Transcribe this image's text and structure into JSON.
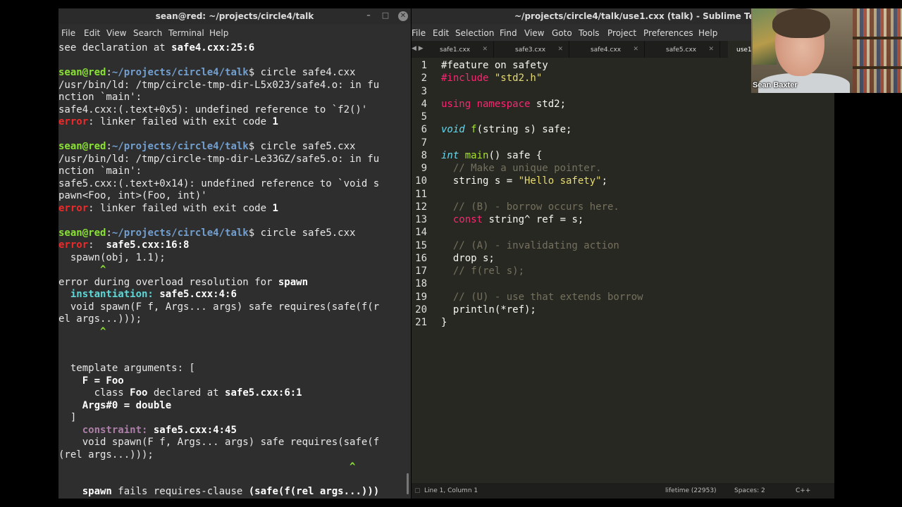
{
  "terminal": {
    "title": "sean@red: ~/projects/circle4/talk",
    "controls": {
      "minimize": "–",
      "maximize": "□",
      "close": "✕"
    },
    "menu": [
      "File",
      "Edit",
      "View",
      "Search",
      "Terminal",
      "Help"
    ],
    "lines": [
      [
        {
          "t": "see declaration at "
        },
        {
          "t": "safe4.cxx:25:6",
          "c": "w"
        }
      ],
      [],
      [
        {
          "t": "sean@red",
          "c": "g"
        },
        {
          "t": ":"
        },
        {
          "t": "~/projects/circle4/talk",
          "c": "b"
        },
        {
          "t": "$ circle safe4.cxx"
        }
      ],
      [
        {
          "t": "/usr/bin/ld: /tmp/circle-tmp-dir-L5x023/safe4.o: in fu"
        }
      ],
      [
        {
          "t": "nction `main':"
        }
      ],
      [
        {
          "t": "safe4.cxx:(.text+0x5): undefined reference to `f2()'"
        }
      ],
      [
        {
          "t": "error",
          "c": "r"
        },
        {
          "t": ": linker failed with exit code "
        },
        {
          "t": "1",
          "c": "w"
        }
      ],
      [],
      [
        {
          "t": "sean@red",
          "c": "g"
        },
        {
          "t": ":"
        },
        {
          "t": "~/projects/circle4/talk",
          "c": "b"
        },
        {
          "t": "$ circle safe5.cxx"
        }
      ],
      [
        {
          "t": "/usr/bin/ld: /tmp/circle-tmp-dir-Le33GZ/safe5.o: in fu"
        }
      ],
      [
        {
          "t": "nction `main':"
        }
      ],
      [
        {
          "t": "safe5.cxx:(.text+0x14): undefined reference to `void s"
        }
      ],
      [
        {
          "t": "pawn<Foo, int>(Foo, int)'"
        }
      ],
      [
        {
          "t": "error",
          "c": "r"
        },
        {
          "t": ": linker failed with exit code "
        },
        {
          "t": "1",
          "c": "w"
        }
      ],
      [],
      [
        {
          "t": "sean@red",
          "c": "g"
        },
        {
          "t": ":"
        },
        {
          "t": "~/projects/circle4/talk",
          "c": "b"
        },
        {
          "t": "$ circle safe5.cxx"
        }
      ],
      [
        {
          "t": "error",
          "c": "r"
        },
        {
          "t": ":  "
        },
        {
          "t": "safe5.cxx:16:8",
          "c": "w"
        }
      ],
      [
        {
          "t": "  spawn(obj, 1.1);"
        }
      ],
      [
        {
          "t": "       ^",
          "c": "gc"
        }
      ],
      [
        {
          "t": "error during overload resolution for "
        },
        {
          "t": "spawn",
          "c": "w"
        }
      ],
      [
        {
          "t": "  "
        },
        {
          "t": "instantiation:",
          "c": "c"
        },
        {
          "t": " "
        },
        {
          "t": "safe5.cxx:4:6",
          "c": "w"
        }
      ],
      [
        {
          "t": "  void spawn(F f, Args... args) safe requires(safe(f(r"
        }
      ],
      [
        {
          "t": "el args...)));"
        }
      ],
      [
        {
          "t": "       ^",
          "c": "gc"
        }
      ],
      [],
      [],
      [
        {
          "t": "  template arguments: ["
        }
      ],
      [
        {
          "t": "    "
        },
        {
          "t": "F = Foo",
          "c": "w"
        }
      ],
      [
        {
          "t": "      class "
        },
        {
          "t": "Foo",
          "c": "w"
        },
        {
          "t": " declared at "
        },
        {
          "t": "safe5.cxx:6:1",
          "c": "w"
        }
      ],
      [
        {
          "t": "    "
        },
        {
          "t": "Args#0 = double",
          "c": "w"
        }
      ],
      [
        {
          "t": "  ]"
        }
      ],
      [
        {
          "t": "    "
        },
        {
          "t": "constraint:",
          "c": "m"
        },
        {
          "t": " "
        },
        {
          "t": "safe5.cxx:4:45",
          "c": "w"
        }
      ],
      [
        {
          "t": "    void spawn(F f, Args... args) safe requires(safe(f"
        }
      ],
      [
        {
          "t": "(rel args...)));"
        }
      ],
      [
        {
          "t": "                                                 ^",
          "c": "gc"
        }
      ],
      [],
      [
        {
          "t": "    "
        },
        {
          "t": "spawn",
          "c": "w"
        },
        {
          "t": " fails requires-clause "
        },
        {
          "t": "(safe(f(rel args...)))",
          "c": "w"
        }
      ],
      [],
      [
        {
          "t": "sean@red",
          "c": "g"
        },
        {
          "t": ":"
        },
        {
          "t": "~/projects/circle4/talk",
          "c": "b"
        },
        {
          "t": "$ circle safe5.cxx "
        }
      ]
    ]
  },
  "sublime": {
    "title": "~/projects/circle4/talk/use1.cxx (talk) - Sublime Text",
    "menu": [
      "File",
      "Edit",
      "Selection",
      "Find",
      "View",
      "Goto",
      "Tools",
      "Project",
      "Preferences",
      "Help"
    ],
    "tabs": [
      "safe1.cxx",
      "safe3.cxx",
      "safe4.cxx",
      "safe5.cxx",
      "use1"
    ],
    "active_tab": "use1",
    "code": [
      [
        {
          "t": "#feature on safety"
        }
      ],
      [
        {
          "t": "#include ",
          "c": "kw"
        },
        {
          "t": "\"std2.h\"",
          "c": "st"
        }
      ],
      [],
      [
        {
          "t": "using namespace ",
          "c": "kw"
        },
        {
          "t": "std2;"
        }
      ],
      [],
      [
        {
          "t": "void ",
          "c": "ty"
        },
        {
          "t": "f",
          "c": "fn"
        },
        {
          "t": "(string s) safe;"
        }
      ],
      [],
      [
        {
          "t": "int ",
          "c": "ty"
        },
        {
          "t": "main",
          "c": "fn"
        },
        {
          "t": "() safe {"
        }
      ],
      [
        {
          "t": "  // Make a unique pointer.",
          "c": "cm"
        }
      ],
      [
        {
          "t": "  string s = "
        },
        {
          "t": "\"Hello safety\"",
          "c": "st"
        },
        {
          "t": ";"
        }
      ],
      [],
      [
        {
          "t": "  // (B) - borrow occurs here.",
          "c": "cm"
        }
      ],
      [
        {
          "t": "  "
        },
        {
          "t": "const",
          "c": "kw"
        },
        {
          "t": " string^ ref = s;"
        }
      ],
      [],
      [
        {
          "t": "  // (A) - invalidating action",
          "c": "cm"
        }
      ],
      [
        {
          "t": "  drop s;"
        }
      ],
      [
        {
          "t": "  // f(rel s);",
          "c": "cm"
        }
      ],
      [],
      [
        {
          "t": "  // (U) - use that extends borrow",
          "c": "cm"
        }
      ],
      [
        {
          "t": "  println(*ref);"
        }
      ],
      [
        {
          "t": "}"
        }
      ]
    ],
    "status": {
      "position": "Line 1, Column 1",
      "lifetime": "lifetime (22953)",
      "spaces": "Spaces: 2",
      "syntax": "C++"
    }
  },
  "webcam": {
    "name": "Sean Baxter"
  }
}
